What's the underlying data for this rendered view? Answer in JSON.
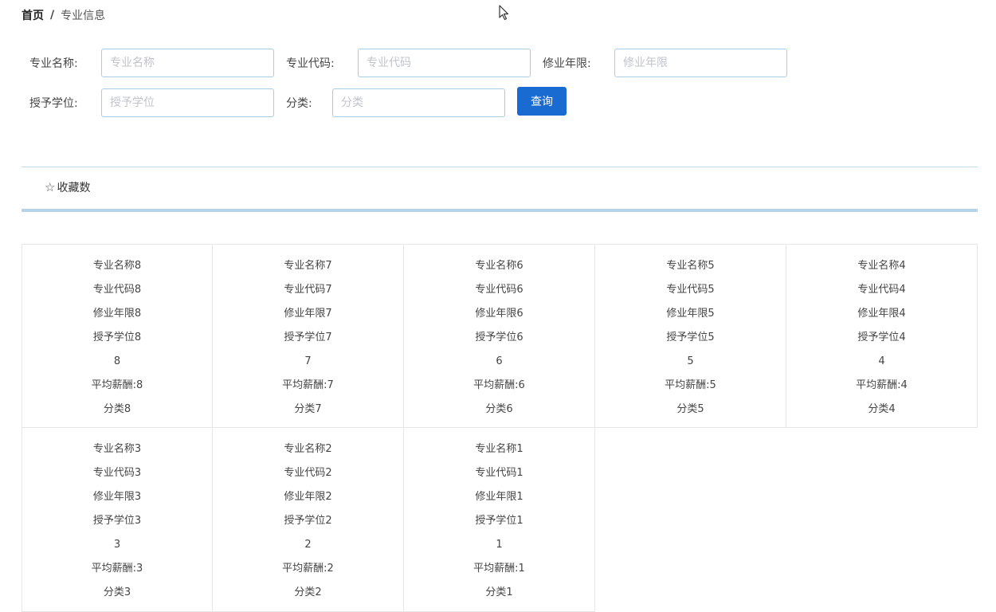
{
  "breadcrumb": {
    "home": "首页",
    "separator": "/",
    "current": "专业信息"
  },
  "search": {
    "fields": [
      {
        "label": "专业名称:",
        "placeholder": "专业名称",
        "value": ""
      },
      {
        "label": "专业代码:",
        "placeholder": "专业代码",
        "value": ""
      },
      {
        "label": "修业年限:",
        "placeholder": "修业年限",
        "value": ""
      },
      {
        "label": "授予学位:",
        "placeholder": "授予学位",
        "value": ""
      },
      {
        "label": "分类:",
        "placeholder": "分类",
        "value": ""
      }
    ],
    "button_label": "查询"
  },
  "tabs": {
    "favorites_label": "收藏数"
  },
  "cards": [
    {
      "name": "专业名称8",
      "code": "专业代码8",
      "years": "修业年限8",
      "degree": "授予学位8",
      "count": "8",
      "salary": "平均薪酬:8",
      "category": "分类8"
    },
    {
      "name": "专业名称7",
      "code": "专业代码7",
      "years": "修业年限7",
      "degree": "授予学位7",
      "count": "7",
      "salary": "平均薪酬:7",
      "category": "分类7"
    },
    {
      "name": "专业名称6",
      "code": "专业代码6",
      "years": "修业年限6",
      "degree": "授予学位6",
      "count": "6",
      "salary": "平均薪酬:6",
      "category": "分类6"
    },
    {
      "name": "专业名称5",
      "code": "专业代码5",
      "years": "修业年限5",
      "degree": "授予学位5",
      "count": "5",
      "salary": "平均薪酬:5",
      "category": "分类5"
    },
    {
      "name": "专业名称4",
      "code": "专业代码4",
      "years": "修业年限4",
      "degree": "授予学位4",
      "count": "4",
      "salary": "平均薪酬:4",
      "category": "分类4"
    },
    {
      "name": "专业名称3",
      "code": "专业代码3",
      "years": "修业年限3",
      "degree": "授予学位3",
      "count": "3",
      "salary": "平均薪酬:3",
      "category": "分类3"
    },
    {
      "name": "专业名称2",
      "code": "专业代码2",
      "years": "修业年限2",
      "degree": "授予学位2",
      "count": "2",
      "salary": "平均薪酬:2",
      "category": "分类2"
    },
    {
      "name": "专业名称1",
      "code": "专业代码1",
      "years": "修业年限1",
      "degree": "授予学位1",
      "count": "1",
      "salary": "平均薪酬:1",
      "category": "分类1"
    }
  ],
  "icons": {
    "favorites": "star-outline-icon",
    "cursor": "mouse-pointer-icon"
  },
  "colors": {
    "primary_button": "#1a6bd1",
    "input_border": "#a8cde6",
    "tab_underline": "#b6d3e8"
  }
}
